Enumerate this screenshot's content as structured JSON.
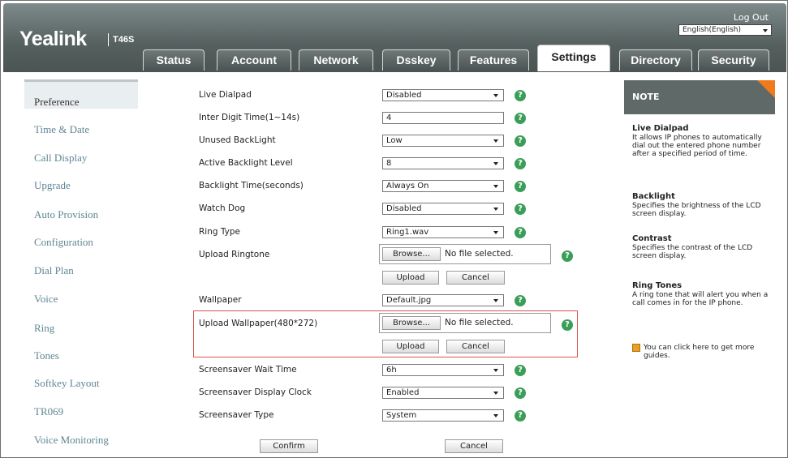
{
  "header": {
    "logo": "Yealink",
    "model": "T46S",
    "logout": "Log Out",
    "language": "English(English)",
    "tabs": [
      "Status",
      "Account",
      "Network",
      "Dsskey",
      "Features",
      "Settings",
      "Directory",
      "Security"
    ],
    "active_tab": "Settings"
  },
  "sidebar": {
    "items": [
      "Preference",
      "Time & Date",
      "Call Display",
      "Upgrade",
      "Auto Provision",
      "Configuration",
      "Dial Plan",
      "Voice",
      "Ring",
      "Tones",
      "Softkey Layout",
      "TR069",
      "Voice Monitoring"
    ],
    "active": "Preference"
  },
  "form": {
    "live_dialpad": {
      "label": "Live Dialpad",
      "value": "Disabled"
    },
    "inter_digit": {
      "label": "Inter Digit Time(1~14s)",
      "value": "4"
    },
    "unused_backlight": {
      "label": "Unused BackLight",
      "value": "Low"
    },
    "active_backlight": {
      "label": "Active Backlight Level",
      "value": "8"
    },
    "backlight_time": {
      "label": "Backlight Time(seconds)",
      "value": "Always On"
    },
    "watch_dog": {
      "label": "Watch Dog",
      "value": "Disabled"
    },
    "ring_type": {
      "label": "Ring Type",
      "value": "Ring1.wav"
    },
    "upload_ringtone": {
      "label": "Upload Ringtone",
      "browse": "Browse...",
      "nofile": "No file selected.",
      "upload": "Upload",
      "cancel": "Cancel"
    },
    "wallpaper": {
      "label": "Wallpaper",
      "value": "Default.jpg"
    },
    "upload_wallpaper": {
      "label": "Upload Wallpaper(480*272)",
      "browse": "Browse...",
      "nofile": "No file selected.",
      "upload": "Upload",
      "cancel": "Cancel"
    },
    "screensaver_wait": {
      "label": "Screensaver Wait Time",
      "value": "6h"
    },
    "screensaver_clock": {
      "label": "Screensaver Display Clock",
      "value": "Enabled"
    },
    "screensaver_type": {
      "label": "Screensaver Type",
      "value": "System"
    },
    "confirm": "Confirm",
    "cancel": "Cancel"
  },
  "note": {
    "title": "NOTE",
    "sections": [
      {
        "title": "Live Dialpad",
        "text": "It allows IP phones to automatically dial out the entered phone number after a specified period of time."
      },
      {
        "title": "Backlight",
        "text": "Specifies the brightness of the LCD screen display."
      },
      {
        "title": "Contrast",
        "text": "Specifies the contrast of the LCD screen display."
      },
      {
        "title": "Ring Tones",
        "text": "A ring tone that will alert you when a call comes in for the IP phone."
      }
    ],
    "guide": "You can click here to get more guides."
  },
  "colors": {
    "header": "#55605f",
    "help": "#3b9e58",
    "accent": "#f07b1d",
    "highlight": "#d9534f"
  }
}
